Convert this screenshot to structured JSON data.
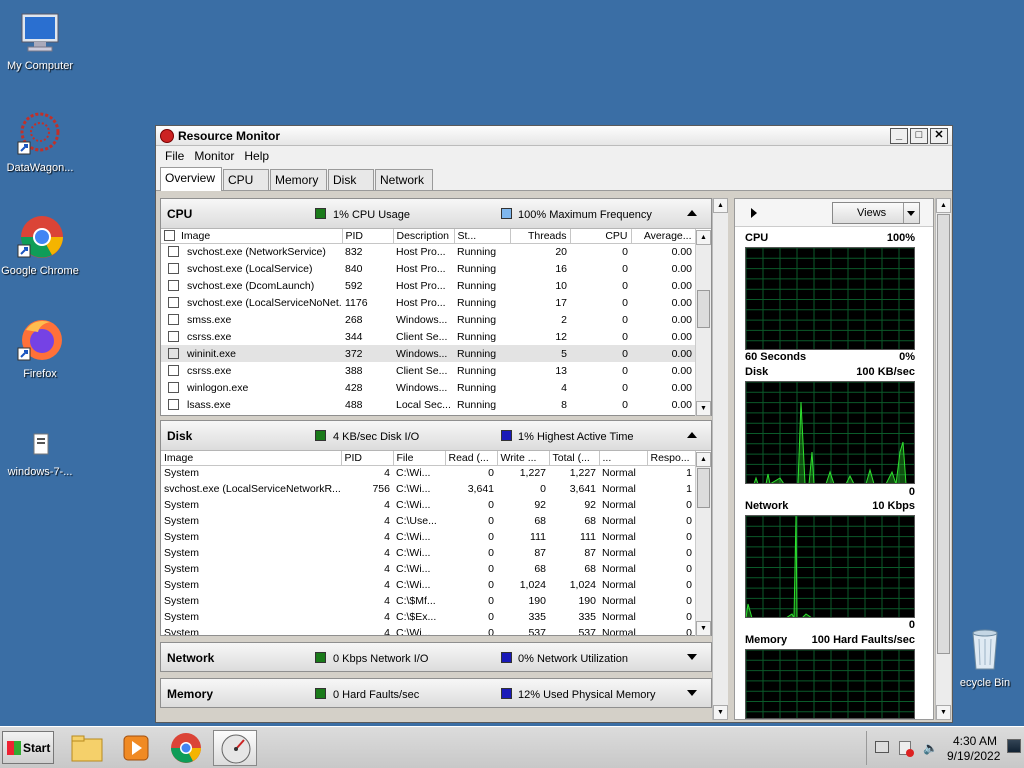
{
  "desktop": {
    "icons": [
      {
        "label": "My Computer",
        "icon": "computer-icon"
      },
      {
        "label": "DataWagon...",
        "icon": "datawagon-icon"
      },
      {
        "label": "Google Chrome",
        "icon": "chrome-icon"
      },
      {
        "label": "Firefox",
        "icon": "firefox-icon"
      },
      {
        "label": "windows-7-...",
        "icon": "file-icon"
      },
      {
        "label": "ecycle Bin",
        "icon": "recycle-bin-icon"
      }
    ]
  },
  "window": {
    "title": "Resource Monitor",
    "menu": [
      "File",
      "Monitor",
      "Help"
    ],
    "tabs": [
      "Overview",
      "CPU",
      "Memory",
      "Disk",
      "Network"
    ],
    "active_tab": "Overview"
  },
  "cpu": {
    "title": "CPU",
    "stat1": "1% CPU Usage",
    "stat2": "100% Maximum Frequency",
    "stat1_color": "#1a7a1a",
    "stat2_color": "#7fb7ee",
    "columns": [
      "Image",
      "PID",
      "Description",
      "St...",
      "Threads",
      "CPU",
      "Average..."
    ],
    "rows": [
      [
        "svchost.exe (NetworkService)",
        "832",
        "Host Pro...",
        "Running",
        "20",
        "0",
        "0.00"
      ],
      [
        "svchost.exe (LocalService)",
        "840",
        "Host Pro...",
        "Running",
        "16",
        "0",
        "0.00"
      ],
      [
        "svchost.exe (DcomLaunch)",
        "592",
        "Host Pro...",
        "Running",
        "10",
        "0",
        "0.00"
      ],
      [
        "svchost.exe (LocalServiceNoNet...",
        "1176",
        "Host Pro...",
        "Running",
        "17",
        "0",
        "0.00"
      ],
      [
        "smss.exe",
        "268",
        "Windows...",
        "Running",
        "2",
        "0",
        "0.00"
      ],
      [
        "csrss.exe",
        "344",
        "Client Se...",
        "Running",
        "12",
        "0",
        "0.00"
      ],
      [
        "wininit.exe",
        "372",
        "Windows...",
        "Running",
        "5",
        "0",
        "0.00"
      ],
      [
        "csrss.exe",
        "388",
        "Client Se...",
        "Running",
        "13",
        "0",
        "0.00"
      ],
      [
        "winlogon.exe",
        "428",
        "Windows...",
        "Running",
        "4",
        "0",
        "0.00"
      ],
      [
        "lsass.exe",
        "488",
        "Local Sec...",
        "Running",
        "8",
        "0",
        "0.00"
      ]
    ],
    "highlighted_row": 6
  },
  "disk": {
    "title": "Disk",
    "stat1": "4 KB/sec Disk I/O",
    "stat2": "1% Highest Active Time",
    "stat1_color": "#1a7a1a",
    "stat2_color": "#1a1ab8",
    "columns": [
      "Image",
      "PID",
      "File",
      "Read (...",
      "Write ...",
      "Total (...",
      "...",
      "Respo..."
    ],
    "rows": [
      [
        "System",
        "4",
        "C:\\Wi...",
        "0",
        "1,227",
        "1,227",
        "Normal",
        "1"
      ],
      [
        "svchost.exe (LocalServiceNetworkR...",
        "756",
        "C:\\Wi...",
        "3,641",
        "0",
        "3,641",
        "Normal",
        "1"
      ],
      [
        "System",
        "4",
        "C:\\Wi...",
        "0",
        "92",
        "92",
        "Normal",
        "0"
      ],
      [
        "System",
        "4",
        "C:\\Use...",
        "0",
        "68",
        "68",
        "Normal",
        "0"
      ],
      [
        "System",
        "4",
        "C:\\Wi...",
        "0",
        "111",
        "111",
        "Normal",
        "0"
      ],
      [
        "System",
        "4",
        "C:\\Wi...",
        "0",
        "87",
        "87",
        "Normal",
        "0"
      ],
      [
        "System",
        "4",
        "C:\\Wi...",
        "0",
        "68",
        "68",
        "Normal",
        "0"
      ],
      [
        "System",
        "4",
        "C:\\Wi...",
        "0",
        "1,024",
        "1,024",
        "Normal",
        "0"
      ],
      [
        "System",
        "4",
        "C:\\$Mf...",
        "0",
        "190",
        "190",
        "Normal",
        "0"
      ],
      [
        "System",
        "4",
        "C:\\$Ex...",
        "0",
        "335",
        "335",
        "Normal",
        "0"
      ],
      [
        "System",
        "4",
        "C:\\Wi...",
        "0",
        "537",
        "537",
        "Normal",
        "0"
      ]
    ]
  },
  "network": {
    "title": "Network",
    "stat1": "0 Kbps Network I/O",
    "stat2": "0% Network Utilization",
    "stat1_color": "#1a7a1a",
    "stat2_color": "#1a1ab8"
  },
  "memory": {
    "title": "Memory",
    "stat1": "0 Hard Faults/sec",
    "stat2": "12% Used Physical Memory",
    "stat1_color": "#1a7a1a",
    "stat2_color": "#1a1ab8"
  },
  "graphs": {
    "views_label": "Views",
    "cpu": {
      "label": "CPU",
      "max": "100%",
      "time": "60 Seconds",
      "min": "0%"
    },
    "disk": {
      "label": "Disk",
      "max": "100 KB/sec",
      "min": "0"
    },
    "network": {
      "label": "Network",
      "max": "10 Kbps",
      "min": "0"
    },
    "memory": {
      "label": "Memory",
      "max": "100 Hard Faults/sec"
    }
  },
  "taskbar": {
    "start_label": "Start",
    "apps": [
      "explorer-icon",
      "media-player-icon",
      "chrome-icon",
      "resource-monitor-icon"
    ],
    "time": "4:30 AM",
    "date": "9/19/2022"
  }
}
